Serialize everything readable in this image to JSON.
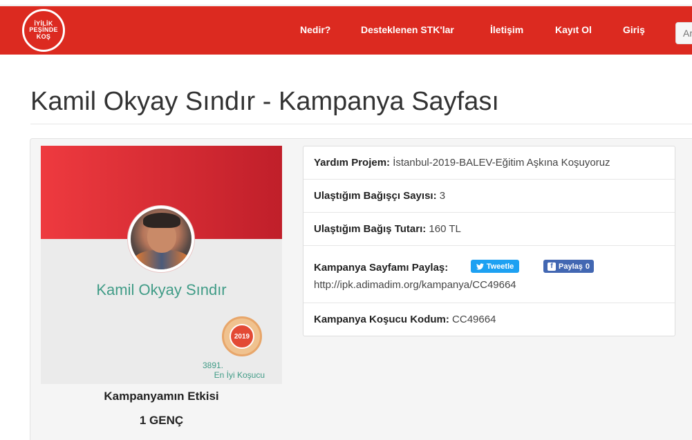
{
  "logo": {
    "line1": "İYİLİK",
    "line2": "PEŞİNDE",
    "line3": "KOŞ"
  },
  "nav": {
    "items": [
      {
        "label": "Nedir?"
      },
      {
        "label": "Desteklenen STK'lar"
      },
      {
        "label": "İletişim"
      },
      {
        "label": "Kayıt Ol"
      },
      {
        "label": "Giriş"
      }
    ],
    "search_placeholder": "Ara"
  },
  "page": {
    "title": "Kamil Okyay Sındır - Kampanya Sayfası"
  },
  "profile": {
    "name": "Kamil Okyay Sındır",
    "badge_year": "2019",
    "rank_number": "3891.",
    "rank_label": "En İyi Koşucu",
    "impact_title": "Kampanyamın Etkisi",
    "impact_value": "1 GENÇ"
  },
  "info": {
    "project_label": "Yardım Projem:",
    "project_value": "İstanbul-2019-BALEV-Eğitim Aşkına Koşuyoruz",
    "donors_label": "Ulaştığım Bağışçı Sayısı:",
    "donors_value": "3",
    "amount_label": "Ulaştığım Bağış Tutarı:",
    "amount_value": "160 TL",
    "share_label": "Kampanya Sayfamı Paylaş:",
    "tweet_label": "Tweetle",
    "fb_label": "Paylaş",
    "fb_count": "0",
    "share_url": "http://ipk.adimadim.org/kampanya/CC49664",
    "code_label": "Kampanya Koşucu Kodum:",
    "code_value": "CC49664"
  },
  "colors": {
    "brand_red": "#dc2a20",
    "name_green": "#3f9b86",
    "twitter_blue": "#1da1f2",
    "facebook_blue": "#4267b2"
  }
}
